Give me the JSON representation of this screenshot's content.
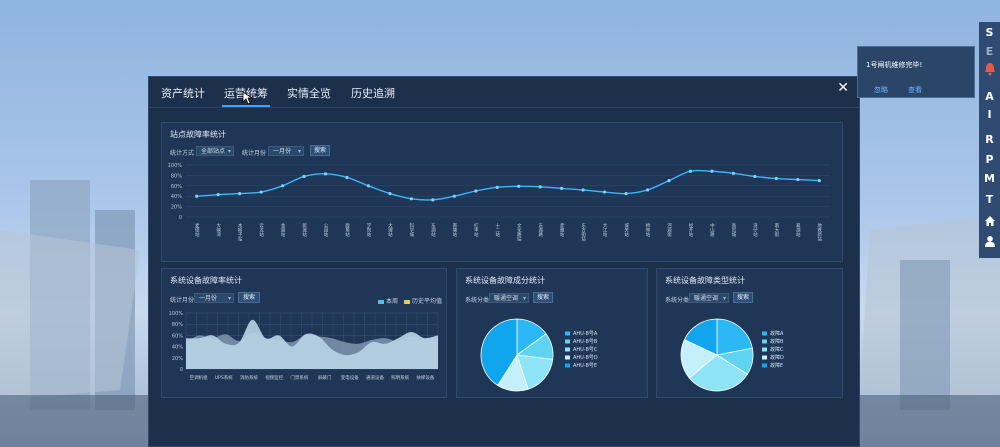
{
  "tabs": [
    "资产统计",
    "运营统筹",
    "实情全览",
    "历史追溯"
  ],
  "close_symbol": "✕",
  "station_panel": {
    "title": "站点故障率统计",
    "filter1_label": "统计方式",
    "filter1_value": "全部站点",
    "filter2_label": "统计月份",
    "filter2_value": "一月份",
    "search": "搜索",
    "yticks": [
      "100%",
      "80%",
      "60%",
      "40%",
      "20%",
      "0"
    ]
  },
  "system_panel": {
    "title": "系统设备故障率统计",
    "filter_label": "统计月份",
    "filter_value": "一月份",
    "search": "搜索",
    "legend": [
      "本周",
      "历史平均值"
    ],
    "yticks": [
      "100%",
      "80%",
      "60%",
      "40%",
      "20%",
      "0"
    ],
    "xlabels": [
      "空调机组",
      "UPS系统",
      "消防系统",
      "视频监控",
      "门禁系统",
      "屏蔽门",
      "变电设备",
      "通道设备",
      "照明系统",
      "扶梯设备"
    ]
  },
  "composition_panel": {
    "title": "系统设备故障成分统计",
    "filter_label": "系统分类",
    "filter_value": "暖通空调",
    "search": "搜索",
    "legend": [
      "AHU-B号A",
      "AHU-B号B",
      "AHU-B号C",
      "AHU-B号D",
      "AHU-B号E"
    ]
  },
  "type_panel": {
    "title": "系统设备故障类型统计",
    "filter_label": "系统分类",
    "filter_value": "暖通空调",
    "search": "搜索",
    "legend": [
      "故障A",
      "故障B",
      "故障C",
      "故障D",
      "故障E"
    ]
  },
  "notification": {
    "message": "1号闸机维修完毕!",
    "ignore": "忽略",
    "view": "查看"
  },
  "sidebar": [
    "S",
    "E",
    "A",
    "I",
    "R",
    "P",
    "M",
    "T"
  ],
  "colors": {
    "accent": "#3aa3ff",
    "line": "#39b6ff",
    "area_this_week": "#b9d4e6",
    "area_history": "#7f97b0",
    "pie": [
      "#2bb8f5",
      "#5ed4f2",
      "#8ee3f7",
      "#c3f0fb",
      "#0fa6ee"
    ],
    "bell": "#e35a4a"
  },
  "chart_data": [
    {
      "type": "line",
      "title": "站点故障率统计",
      "x": [
        "麦德站",
        "大峡湾",
        "木棉子站",
        "云龙站",
        "会展站",
        "新城站",
        "公园站",
        "鹿角站",
        "学院站",
        "大理站",
        "科学城",
        "东湖站",
        "南塘站",
        "红丰站",
        "十二站",
        "文化路站",
        "东湖路",
        "赤雅站",
        "东方街站",
        "大江站",
        "城关站",
        "桥林站",
        "河源街",
        "经开站",
        "中山路",
        "商贸城",
        "湾仔站",
        "南大街",
        "翠湖站",
        "地铁新站"
      ],
      "series": [
        {
          "values": [
            40,
            43,
            45,
            48,
            60,
            78,
            83,
            76,
            60,
            45,
            35,
            33,
            40,
            50,
            57,
            59,
            58,
            55,
            52,
            48,
            45,
            52,
            70,
            88,
            88,
            84,
            78,
            74,
            72,
            70
          ]
        }
      ],
      "ylim": [
        0,
        100
      ],
      "yunit": "%"
    },
    {
      "type": "area",
      "title": "系统设备故障率统计",
      "categories": [
        "空调机组",
        "UPS系统",
        "消防系统",
        "视频监控",
        "门禁系统",
        "屏蔽门",
        "变电设备",
        "通道设备",
        "照明系统",
        "扶梯设备"
      ],
      "series": [
        {
          "name": "本周",
          "values": [
            55,
            55,
            60,
            45,
            47,
            88,
            55,
            60,
            40,
            62,
            58,
            35,
            25,
            30,
            48,
            45,
            55,
            66,
            55,
            60
          ]
        },
        {
          "name": "历史平均值",
          "values": [
            48,
            60,
            55,
            62,
            50,
            65,
            55,
            52,
            48,
            60,
            58,
            55,
            48,
            45,
            52,
            55,
            50,
            58,
            55,
            60
          ]
        }
      ],
      "ylim": [
        0,
        100
      ]
    },
    {
      "type": "pie",
      "title": "系统设备故障成分统计",
      "labels": [
        "AHU-B号A",
        "AHU-B号B",
        "AHU-B号C",
        "AHU-B号D",
        "AHU-B号E"
      ],
      "values": [
        15,
        12,
        18,
        14,
        41
      ]
    },
    {
      "type": "pie",
      "title": "系统设备故障类型统计",
      "labels": [
        "故障A",
        "故障B",
        "故障C",
        "故障D",
        "故障E"
      ],
      "values": [
        22,
        12,
        30,
        18,
        18
      ]
    }
  ]
}
